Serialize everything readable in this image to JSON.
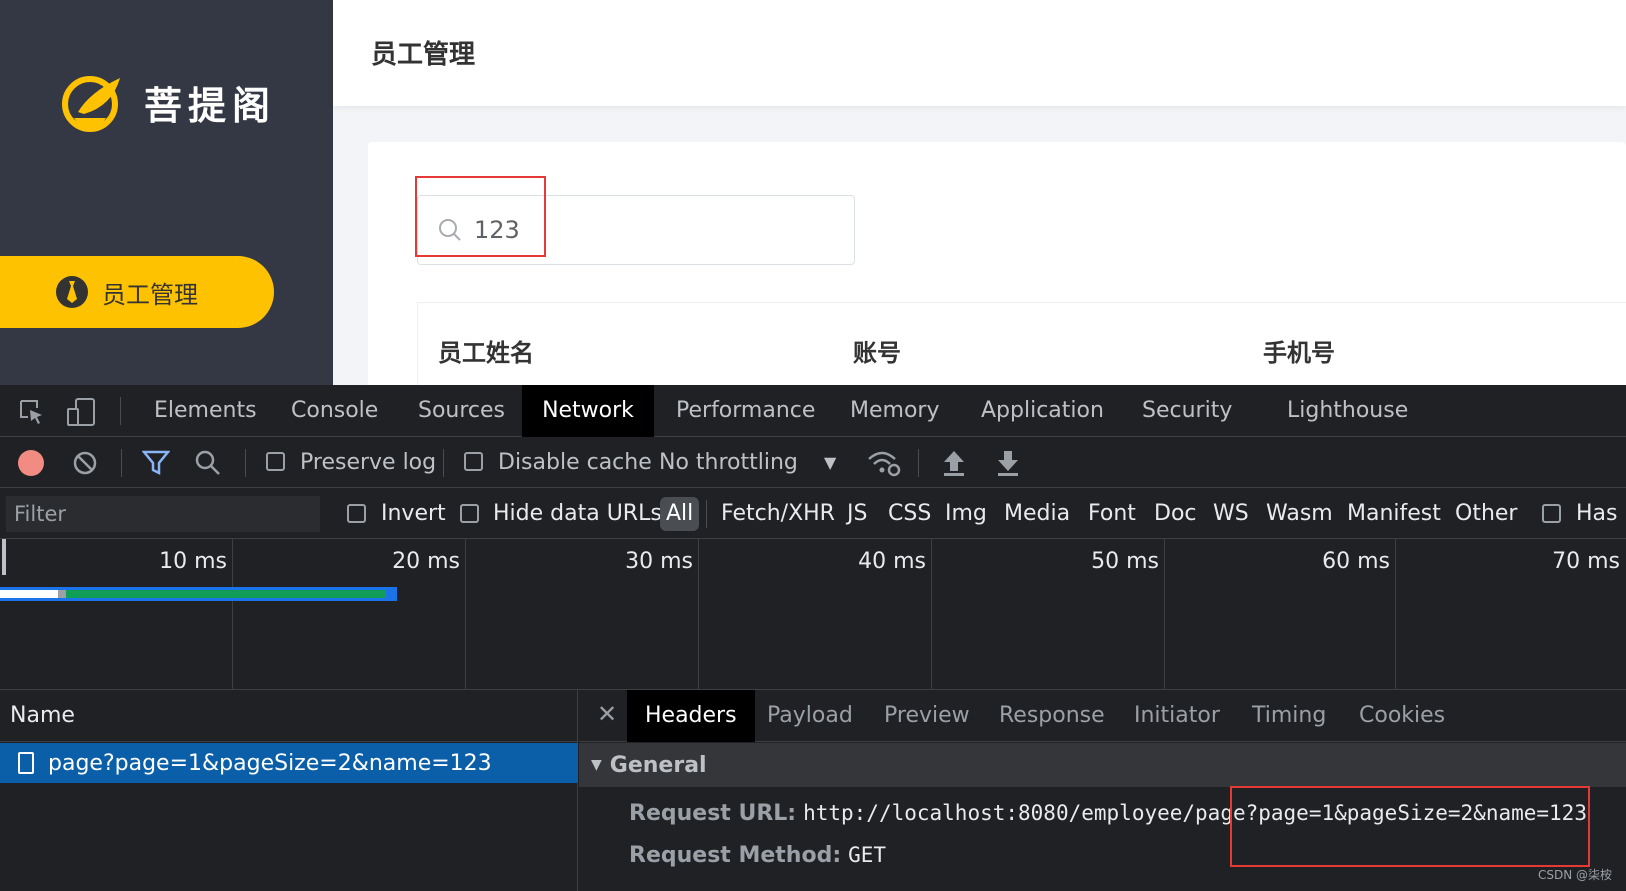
{
  "app": {
    "logo_text": "菩提阁",
    "nav_item_label": "员工管理",
    "page_title": "员工管理",
    "search": {
      "value": "123"
    },
    "table_headers": [
      "员工姓名",
      "账号",
      "手机号"
    ],
    "colors": {
      "sidebar": "#343744",
      "accent": "#ffc200"
    }
  },
  "devtools": {
    "tabs": [
      "Elements",
      "Console",
      "Sources",
      "Network",
      "Performance",
      "Memory",
      "Application",
      "Security",
      "Lighthouse"
    ],
    "active_tab": "Network",
    "toolbar": {
      "preserve_log": "Preserve log",
      "disable_cache": "Disable cache",
      "throttling": "No throttling"
    },
    "filter": {
      "placeholder": "Filter",
      "invert": "Invert",
      "hide_data_urls": "Hide data URLs",
      "types": [
        "All",
        "Fetch/XHR",
        "JS",
        "CSS",
        "Img",
        "Media",
        "Font",
        "Doc",
        "WS",
        "Wasm",
        "Manifest",
        "Other"
      ],
      "has_blocked": "Has b"
    },
    "timeline_ticks": [
      "10 ms",
      "20 ms",
      "30 ms",
      "40 ms",
      "50 ms",
      "60 ms",
      "70 ms"
    ],
    "name_header": "Name",
    "request_name": "page?page=1&pageSize=2&name=123",
    "detail_tabs": [
      "Headers",
      "Payload",
      "Preview",
      "Response",
      "Initiator",
      "Timing",
      "Cookies"
    ],
    "general_label": "General",
    "request_url_key": "Request URL:",
    "request_url_value": "http://localhost:8080/employee/page?page=1&pageSize=2&name=123",
    "request_method_key": "Request Method:",
    "request_method_value": "GET",
    "watermark": "CSDN @柒桉"
  }
}
